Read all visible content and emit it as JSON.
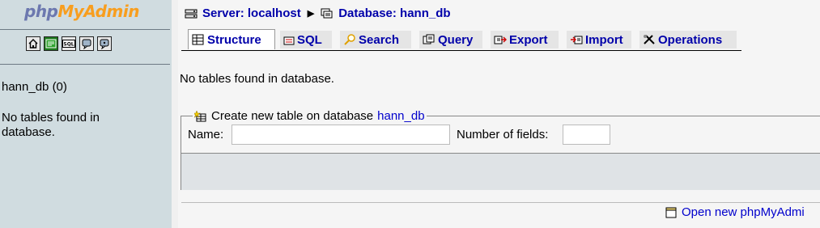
{
  "left": {
    "logo_php": "php",
    "logo_rest": "MyAdmin",
    "icons": [
      "home-icon",
      "query-window-icon",
      "sql-icon",
      "documentation-icon",
      "help-icon"
    ],
    "db_name": "hann_db (0)",
    "message": "No tables found in database."
  },
  "breadcrumb": {
    "server": "Server: localhost",
    "database": "Database: hann_db"
  },
  "tabs": [
    {
      "label": "Structure",
      "icon": "structure-icon",
      "active": true
    },
    {
      "label": "SQL",
      "icon": "sql-icon",
      "active": false
    },
    {
      "label": "Search",
      "icon": "search-icon",
      "active": false
    },
    {
      "label": "Query",
      "icon": "query-icon",
      "active": false
    },
    {
      "label": "Export",
      "icon": "export-icon",
      "active": false
    },
    {
      "label": "Import",
      "icon": "import-icon",
      "active": false
    },
    {
      "label": "Operations",
      "icon": "operations-icon",
      "active": false
    }
  ],
  "main": {
    "message": "No tables found in database.",
    "create_legend_prefix": "Create new table on database",
    "create_legend_db": "hann_db",
    "name_label": "Name:",
    "name_value": "",
    "fields_label": "Number of fields:",
    "fields_value": "",
    "open_new_link": "Open new phpMyAdmi"
  },
  "colors": {
    "left_bg": "#d0dce0",
    "link": "#0000aa",
    "page_bg": "#f5f5f5"
  }
}
